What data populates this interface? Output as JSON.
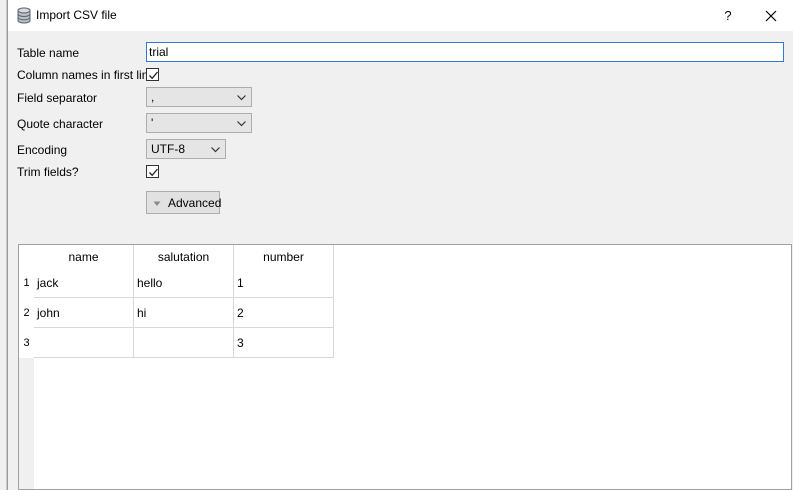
{
  "window": {
    "title": "Import CSV file",
    "help_label": "?"
  },
  "form": {
    "table_name_label": "Table name",
    "table_name_value": "trial",
    "column_names_label": "Column names in first line",
    "column_names_checked": true,
    "field_separator_label": "Field separator",
    "field_separator_value": ",",
    "quote_character_label": "Quote character",
    "quote_character_value": "'",
    "encoding_label": "Encoding",
    "encoding_value": "UTF-8",
    "trim_fields_label": "Trim fields?",
    "trim_fields_checked": true,
    "advanced_label": "Advanced"
  },
  "preview": {
    "columns": [
      "name",
      "salutation",
      "number"
    ],
    "row_numbers": [
      "1",
      "2",
      "3"
    ],
    "rows": [
      [
        "jack",
        "hello",
        "1"
      ],
      [
        "john",
        "hi",
        "2"
      ],
      [
        "",
        "",
        "3"
      ]
    ]
  },
  "icons": {
    "title": "database-icon",
    "close": "close-icon",
    "dropdown": "chevron-down-icon",
    "check": "checkmark-icon",
    "advanced": "triangle-down-icon"
  }
}
